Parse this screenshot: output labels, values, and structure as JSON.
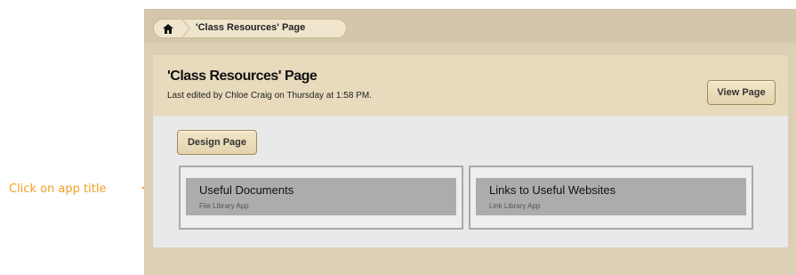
{
  "annotation": {
    "text": "Click on app title"
  },
  "breadcrumb": {
    "home_icon": "home-icon",
    "current": "'Class Resources' Page"
  },
  "header": {
    "title": "'Class Resources' Page",
    "subtitle": "Last edited by Chloe Craig on Thursday at 1:58 PM.",
    "view_button": "View Page"
  },
  "toolbar": {
    "design_button": "Design Page"
  },
  "apps": [
    {
      "name": "Useful Documents",
      "type": "File Library App"
    },
    {
      "name": "Links to Useful Websites",
      "type": "Link Library App"
    }
  ],
  "colors": {
    "annotation": "#f0a020",
    "frame_bg": "#dccfb5",
    "header_bg": "#e8dbbd",
    "content_bg": "#e9e9e9",
    "app_title_bg": "#acacac"
  }
}
